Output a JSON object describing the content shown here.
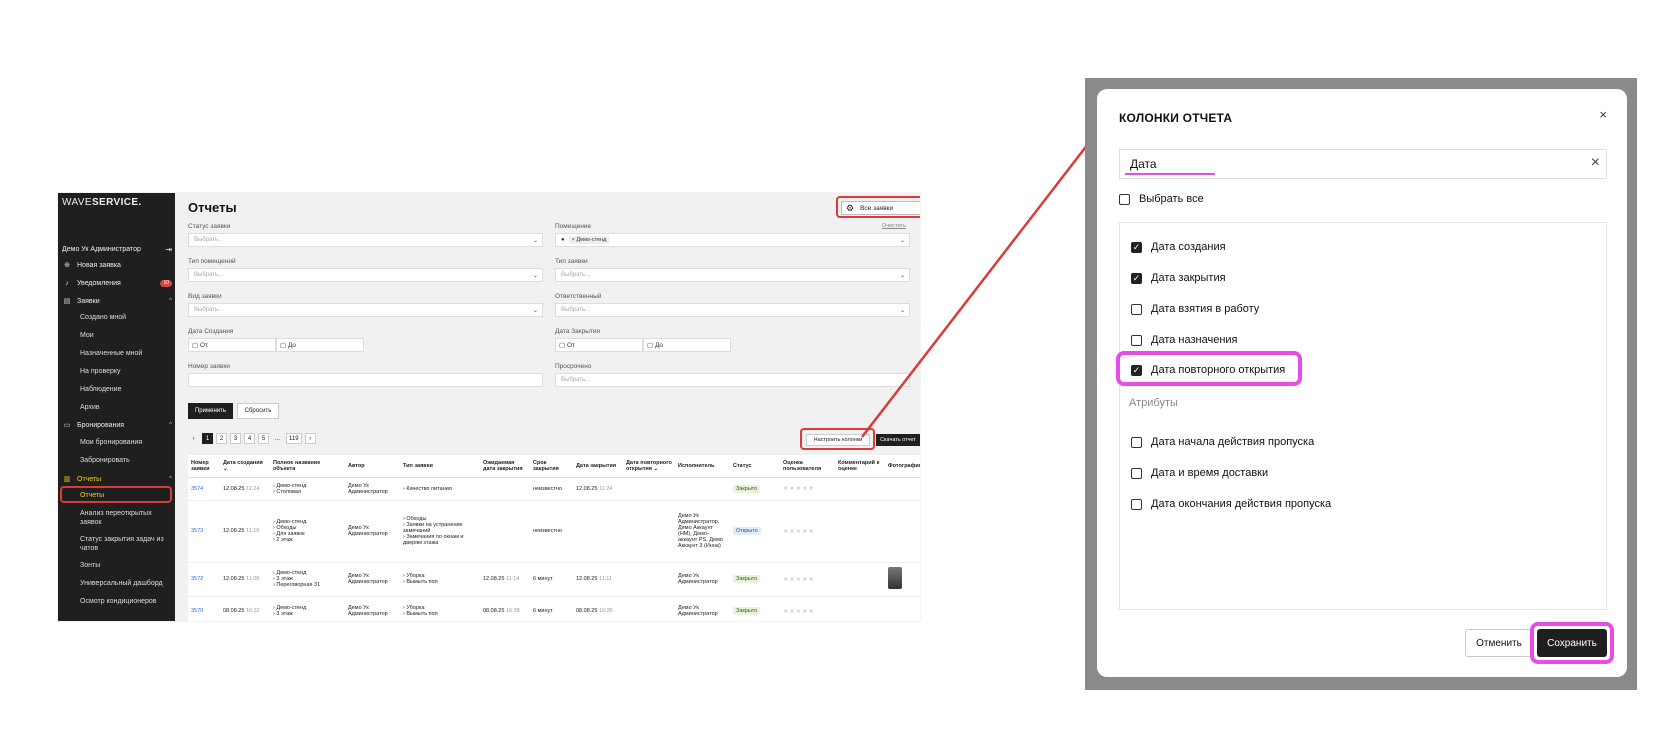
{
  "app": {
    "logo_light": "WAVE",
    "logo_bold": "SERVICE.",
    "user_name": "Демо Ук Администратор",
    "nav": {
      "new_request": "Новая заявка",
      "notifications": "Уведомления",
      "notifications_badge": "10",
      "requests": "Заявки",
      "requests_sub": [
        "Создано мной",
        "Мои",
        "Назначенные мной",
        "На проверку",
        "Наблюдение",
        "Архив"
      ],
      "bookings": "Бронирования",
      "bookings_sub": [
        "Мои бронирования",
        "Забронировать"
      ],
      "reports": "Отчеты",
      "reports_sub": [
        "Отчеты",
        "Анализ переоткрытых заявок",
        "Статус закрытия задач из чатов",
        "Зонты",
        "Универсальный дашборд",
        "Осмотр кондиционеров"
      ]
    },
    "page_title": "Отчеты",
    "scope_select": "Все заявки",
    "filters": {
      "status_label": "Статус заявки",
      "room_label": "Помещение",
      "clear": "Очистить",
      "room_type_label": "Тип помещений",
      "request_type_label": "Тип заявки",
      "kind_label": "Вид заявки",
      "responsible_label": "Ответственный",
      "created_label": "Дата Создания",
      "closed_label": "Дата Закрытия",
      "number_label": "Номер заявки",
      "overdue_label": "Просрочено",
      "placeholder": "Выбрать...",
      "room_chip": "Демо-стенд",
      "from": "От",
      "to": "До"
    },
    "apply": "Применить",
    "reset": "Сбросить",
    "pages": [
      "1",
      "2",
      "3",
      "4",
      "5",
      "...",
      "119"
    ],
    "configure_columns": "Настроить колонки",
    "download_report": "Скачать отчет",
    "table": {
      "headers": [
        "Номер заявки",
        "Дата создания",
        "Полное название объекта",
        "Автор",
        "Тип заявки",
        "Ожидаемая дата закрытия",
        "Срок закрытия",
        "Дата закрытия",
        "Дата повторного открытия",
        "Исполнитель",
        "Статус",
        "Оценка пользователя",
        "Комментарий к оценке",
        "Фотографии"
      ],
      "rows": [
        {
          "num": "3574",
          "date": "12.08.25",
          "time": "11:24",
          "obj": "› Демо-стенд\n  › Столовая",
          "author": "Демо Ук Администратор",
          "type": "› Качество питания",
          "exp": "",
          "term": "неизвестно",
          "closed": "12.08.25",
          "closed_time": "11:24",
          "reopen": "",
          "exec": "",
          "status": "Закрыто"
        },
        {
          "num": "3573",
          "date": "12.08.25",
          "time": "11:16",
          "obj": "› Демо-стенд\n  › Обходы\n    › Для заявок\n      › 2 этаж",
          "author": "Демо Ук Администратор",
          "type": "› Обходы\n  › Заявки на устранение замечаний\n    › Замечания по окнам и дверям этажа",
          "exp": "",
          "term": "неизвестно",
          "closed": "",
          "closed_time": "",
          "reopen": "",
          "exec": "Демо Ук Администратор, Демо Аккаунт (НМ), Демо-аккаунт PS, Демо Аккаунт 3 (Инна)",
          "status": "Открыто"
        },
        {
          "num": "3572",
          "date": "12.08.25",
          "time": "11:08",
          "obj": "› Демо-стенд\n  › 3 этаж\n    › Переговорная 31",
          "author": "Демо Ук Администратор",
          "type": "› Уборка\n  › Вымыть пол",
          "exp": "12.08.25",
          "exp_time": "11:14",
          "term": "6 минут",
          "closed": "12.08.25",
          "closed_time": "11:11",
          "reopen": "",
          "exec": "Демо Ук Администратор",
          "status": "Закрыто"
        },
        {
          "num": "3570",
          "date": "08.08.25",
          "time": "16:32",
          "obj": "› Демо-стенд\n  › 3 этаж",
          "author": "Демо Ук Администратор",
          "type": "› Уборка\n  › Вымыть пол",
          "exp": "08.08.25",
          "exp_time": "16:38",
          "term": "6 минут",
          "closed": "08.08.25",
          "closed_time": "16:35",
          "reopen": "",
          "exec": "Демо Ук Администратор",
          "status": "Закрыто"
        }
      ]
    }
  },
  "modal": {
    "title": "КОЛОНКИ ОТЧЕТА",
    "search_value": "Дата",
    "select_all": "Выбрать все",
    "items": [
      {
        "label": "Дата создания",
        "checked": true
      },
      {
        "label": "Дата закрытия",
        "checked": true
      },
      {
        "label": "Дата взятия в работу",
        "checked": false
      },
      {
        "label": "Дата назначения",
        "checked": false
      },
      {
        "label": "Дата повторного открытия",
        "checked": true
      }
    ],
    "group_title": "Атрибуты",
    "attr_items": [
      {
        "label": "Дата начала действия пропуска",
        "checked": false
      },
      {
        "label": "Дата и время доставки",
        "checked": false
      },
      {
        "label": "Дата окончания действия пропуска",
        "checked": false
      }
    ],
    "cancel": "Отменить",
    "save": "Сохранить"
  },
  "colors": {
    "highlight_red": "#d93a3a",
    "highlight_pink": "#e64ce6",
    "reports_active": "#f2d300"
  }
}
